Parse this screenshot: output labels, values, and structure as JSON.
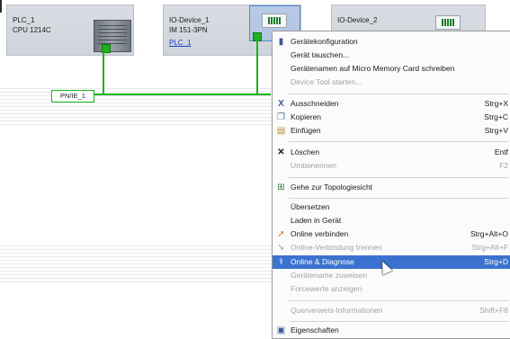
{
  "devices": [
    {
      "name": "PLC_1",
      "type": "CPU 1214C"
    },
    {
      "name": "IO-Device_1",
      "type": "IM 151-3PN",
      "link": "PLC_1"
    },
    {
      "name": "IO-Device_2"
    }
  ],
  "network": {
    "label": "PN/IE_1",
    "line_color": "#19b419"
  },
  "context_menu": {
    "items": [
      {
        "label": "Gerätekonfiguration",
        "icon": "device-config-icon",
        "enabled": true
      },
      {
        "label": "Gerät tauschen...",
        "enabled": true
      },
      {
        "label": "Gerätenamen auf Micro Memory Card schreiben",
        "enabled": true
      },
      {
        "label": "Device Tool starten...",
        "enabled": false
      },
      {
        "label": "Ausschneiden",
        "shortcut": "Strg+X",
        "icon": "cut-icon",
        "enabled": true
      },
      {
        "label": "Kopieren",
        "shortcut": "Strg+C",
        "icon": "copy-icon",
        "enabled": true
      },
      {
        "label": "Einfügen",
        "shortcut": "Strg+V",
        "icon": "paste-icon",
        "enabled": true
      },
      {
        "label": "Löschen",
        "shortcut": "Entf",
        "icon": "delete-icon",
        "enabled": true
      },
      {
        "label": "Umbenennen",
        "shortcut": "F2",
        "enabled": false
      },
      {
        "label": "Gehe zur Topologiesicht",
        "icon": "topology-icon",
        "enabled": true
      },
      {
        "label": "Übersetzen",
        "shortcut": "",
        "enabled": true
      },
      {
        "label": "Laden in Gerät",
        "shortcut": "",
        "enabled": true
      },
      {
        "label": "Online verbinden",
        "shortcut": "Strg+Alt+O",
        "icon": "online-connect-icon",
        "enabled": true
      },
      {
        "label": "Online-Verbindung trennen",
        "shortcut": "Strg+Alt+F",
        "icon": "online-disconnect-icon",
        "enabled": false
      },
      {
        "label": "Online & Diagnose",
        "shortcut": "Strg+D",
        "icon": "diagnose-icon",
        "enabled": true,
        "highlighted": true
      },
      {
        "label": "Gerätename zuweisen",
        "enabled": false
      },
      {
        "label": "Forcewerte anzeigen",
        "enabled": false
      },
      {
        "label": "Querverweis-Informationen",
        "shortcut": "Shift+F8",
        "enabled": false
      },
      {
        "label": "Eigenschaften",
        "icon": "properties-icon",
        "enabled": true
      }
    ]
  },
  "colors": {
    "highlight": "#3b72cf",
    "port_green": "#20b020",
    "device_bg": "#d9dde3"
  }
}
